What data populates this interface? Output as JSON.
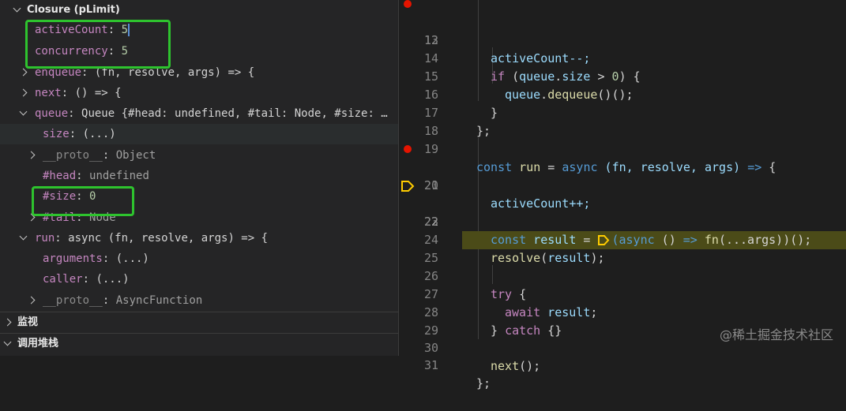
{
  "variables": {
    "scope_title": "Closure (pLimit)",
    "rows": [
      {
        "key": "activeCount",
        "value": "5",
        "value_kind": "num"
      },
      {
        "key": "concurrency",
        "value": "5",
        "value_kind": "num"
      },
      {
        "key": "enqueue",
        "value": "(fn, resolve, args) => {",
        "value_kind": "plain"
      },
      {
        "key": "next",
        "value": "() => {",
        "value_kind": "plain"
      },
      {
        "key": "queue",
        "value": "Queue {#head: undefined, #tail: Node, #size: …",
        "value_kind": "plain"
      },
      {
        "key": "size",
        "value": "(...)",
        "value_kind": "plain"
      },
      {
        "key": "__proto__",
        "value": "Object",
        "value_kind": "plain"
      },
      {
        "key": "#head",
        "value": "undefined",
        "value_kind": "undef"
      },
      {
        "key": "#size",
        "value": "0",
        "value_kind": "num"
      },
      {
        "key": "#tail",
        "value": "Node",
        "value_kind": "plain"
      },
      {
        "key": "run",
        "value": "async (fn, resolve, args) => {",
        "value_kind": "plain"
      },
      {
        "key": "arguments",
        "value": "(...)",
        "value_kind": "plain"
      },
      {
        "key": "caller",
        "value": "(...)",
        "value_kind": "plain"
      },
      {
        "key": "__proto__",
        "value": "AsyncFunction",
        "value_kind": "plain"
      }
    ],
    "sections": {
      "watch": "监视",
      "call_stack": "调用堆栈"
    }
  },
  "editor": {
    "lines": [
      {
        "n": "12",
        "breakpoint": true
      },
      {
        "n": "13"
      },
      {
        "n": "14"
      },
      {
        "n": "15"
      },
      {
        "n": "16"
      },
      {
        "n": "17"
      },
      {
        "n": "18"
      },
      {
        "n": "19"
      },
      {
        "n": "20",
        "breakpoint": true
      },
      {
        "n": "21"
      },
      {
        "n": "22",
        "current": true
      },
      {
        "n": "23"
      },
      {
        "n": "24"
      },
      {
        "n": "25"
      },
      {
        "n": "26"
      },
      {
        "n": "27"
      },
      {
        "n": "28"
      },
      {
        "n": "29"
      },
      {
        "n": "30"
      },
      {
        "n": "31"
      }
    ],
    "code": {
      "l12": "activeCount--;",
      "l14_if": "if",
      "l14_open": " (",
      "l14_queue": "queue",
      "l14_dot": ".",
      "l14_size": "size",
      "l14_rest": " > ",
      "l14_num": "0",
      "l14_end": ") {",
      "l15_queue": "queue",
      "l15_dot": ".",
      "l15_fn": "dequeue",
      "l15_end": "()();",
      "l16": "}",
      "l17": "};",
      "l19_const": "const",
      "l19_run": " run",
      "l19_eq": " = ",
      "l19_async": "async",
      "l19_params": " (fn, resolve, args) ",
      "l19_arrow": "=>",
      "l19_end": " {",
      "l20": "activeCount++;",
      "l22_const": "const",
      "l22_result": " result",
      "l22_eq": " = ",
      "l22_async": "(async",
      "l22_p": " () ",
      "l22_arrow": "=>",
      "l22_fn": " fn",
      "l22_rest": "(...args))();",
      "l24_fn": "resolve",
      "l24_open": "(",
      "l24_var": "result",
      "l24_end": ");",
      "l26_try": "try",
      "l26_end": " {",
      "l27_await": "await",
      "l27_var": " result",
      "l27_end": ";",
      "l28_close": "} ",
      "l28_catch": "catch",
      "l28_end": " {}",
      "l30_fn": "next",
      "l30_end": "();",
      "l31": "};"
    }
  },
  "watermark": "@稀土掘金技术社区",
  "colors": {
    "highlight_box": "#2ec32e",
    "breakpoint": "#e51400",
    "current_line": "#4b4b18",
    "debug_arrow": "#ffcc00"
  }
}
